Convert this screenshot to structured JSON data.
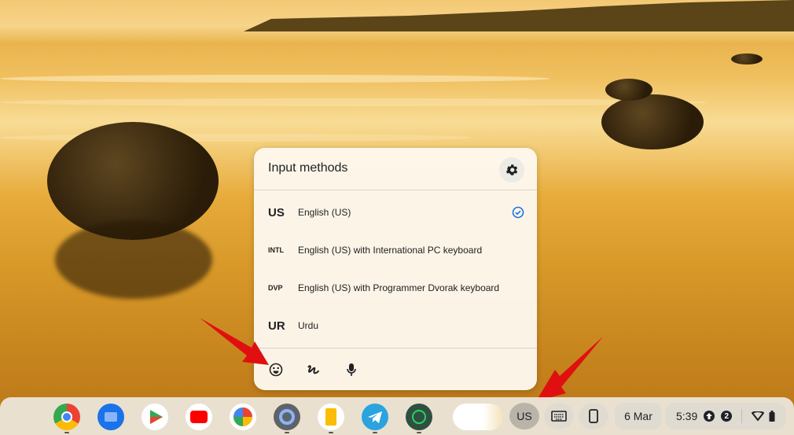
{
  "popup": {
    "title": "Input methods",
    "methods": [
      {
        "code": "US",
        "name": "English (US)",
        "selected": true
      },
      {
        "code": "INTL",
        "name": "English (US) with International PC keyboard",
        "selected": false
      },
      {
        "code": "DVP",
        "name": "English (US) with Programmer Dvorak keyboard",
        "selected": false
      },
      {
        "code": "UR",
        "name": "Urdu",
        "selected": false
      }
    ]
  },
  "shelf": {
    "apps": [
      "Chrome",
      "Files",
      "Play Store",
      "YouTube",
      "Google Photos",
      "Settings",
      "Keep",
      "Telegram",
      "WhatsApp"
    ],
    "ime": "US",
    "date": "6 Mar",
    "time": "5:39",
    "notification_count": "2"
  },
  "colors": {
    "accent": "#1a73e8",
    "arrow": "#e01010"
  }
}
